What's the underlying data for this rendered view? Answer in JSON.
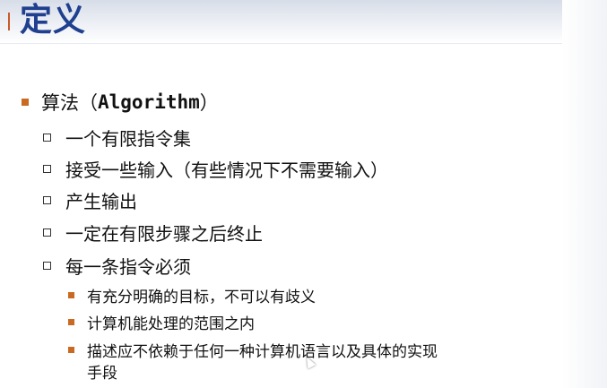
{
  "slide": {
    "title": "定义",
    "bullet": {
      "label_prefix": "算法（",
      "label_term": "Algorithm",
      "label_suffix": "）",
      "subitems": [
        "一个有限指令集",
        "接受一些输入（有些情况下不需要输入）",
        "产生输出",
        "一定在有限步骤之后终止",
        "每一条指令必须"
      ],
      "requirements": [
        "有充分明确的目标，不可以有歧义",
        "计算机能处理的范围之内",
        "描述应不依赖于任何一种计算机语言以及具体的实现",
        "手段"
      ]
    }
  },
  "colors": {
    "title": "#1f3f8f",
    "title_accent": "#c85a2a",
    "bullet": "#c86a22",
    "text": "#111111"
  }
}
